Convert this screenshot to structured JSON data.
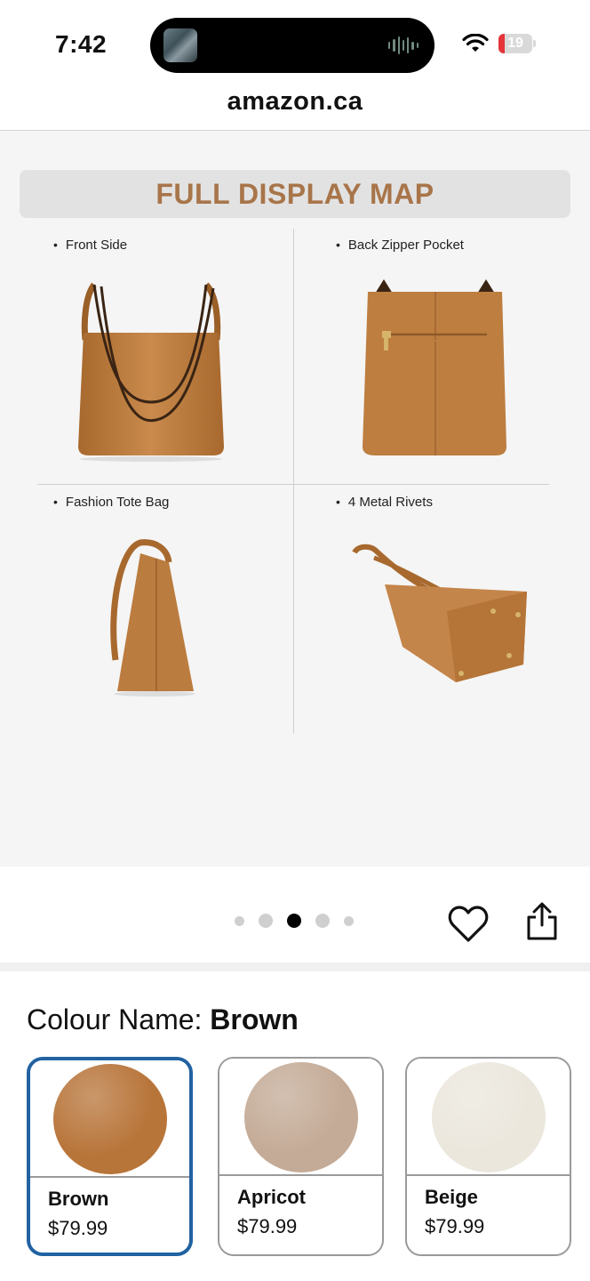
{
  "status_bar": {
    "time": "7:42",
    "battery_level": "19",
    "battery_fraction": 0.19,
    "icons": [
      "wifi-icon",
      "battery-icon",
      "audio-wave-icon"
    ]
  },
  "browser": {
    "url": "amazon.ca"
  },
  "product_image": {
    "banner": "FULL DISPLAY MAP",
    "captions": {
      "front": "Front Side",
      "back": "Back Zipper Pocket",
      "side": "Fashion Tote Bag",
      "bottom": "4 Metal Rivets"
    },
    "carousel": {
      "dot_count": 5,
      "active_index": 2
    }
  },
  "actions": {
    "icons": [
      "heart-icon",
      "share-icon"
    ]
  },
  "colour": {
    "label": "Colour Name:",
    "selected": "Brown",
    "options": [
      {
        "name": "Brown",
        "price": "$79.99",
        "color": "#b8753a",
        "selected": true
      },
      {
        "name": "Apricot",
        "price": "$79.99",
        "color": "#c4ab97",
        "selected": false
      },
      {
        "name": "Beige",
        "price": "$79.99",
        "color": "#ebe7dd",
        "selected": false
      }
    ]
  },
  "colors": {
    "accent_selected": "#2162a1",
    "banner_text": "#a8754a",
    "leather": "#b87839"
  }
}
